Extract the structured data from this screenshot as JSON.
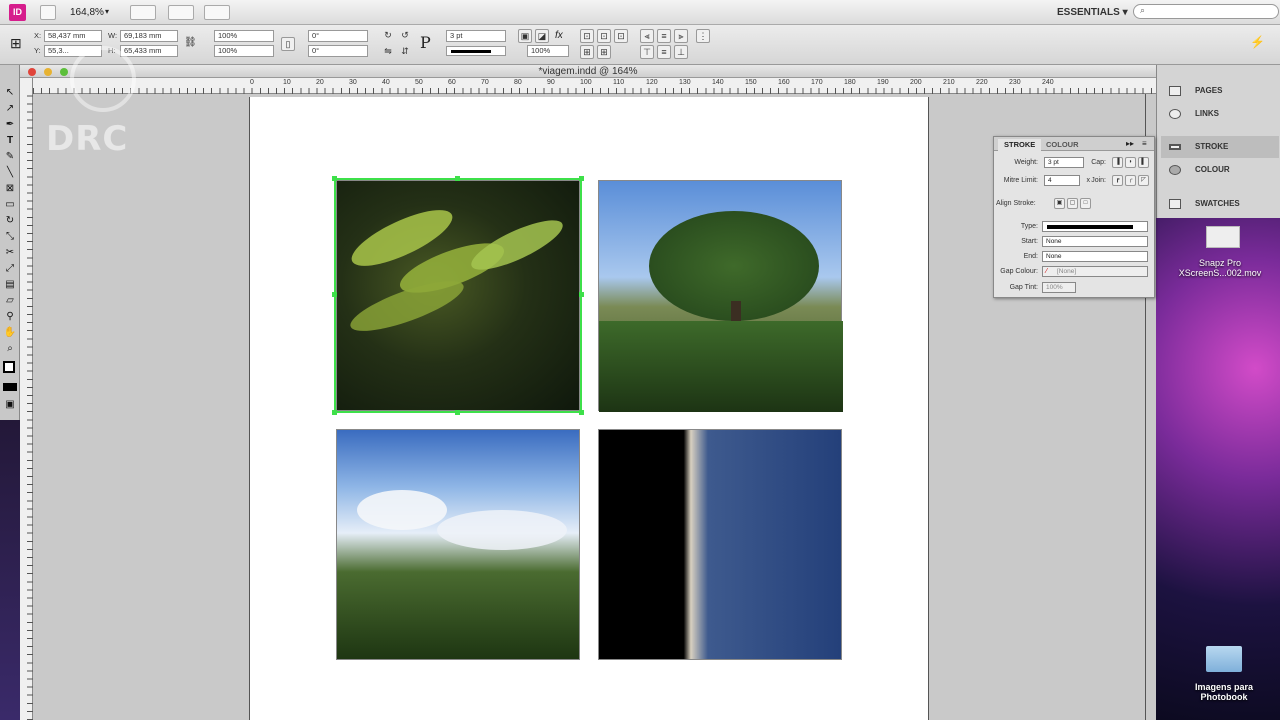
{
  "app": {
    "logo": "ID",
    "zoom": "164,8%",
    "workspace": "ESSENTIALS",
    "search_placeholder": ""
  },
  "control": {
    "x_label": "X:",
    "x_value": "58,437 mm",
    "y_label": "Y:",
    "y_value": "55,3...",
    "w_label": "W:",
    "w_value": "69,183 mm",
    "h_label": "H:",
    "h_value": "65,433 mm",
    "scale_x": "100%",
    "scale_y": "100%",
    "rotate": "0°",
    "shear": "0°",
    "stroke_weight": "3 pt",
    "opacity": "100%"
  },
  "document": {
    "title": "*viagem.indd @ 164%"
  },
  "ruler": {
    "ticks": [
      "0",
      "10",
      "20",
      "30",
      "40",
      "50",
      "60",
      "70",
      "80",
      "90",
      "100",
      "110",
      "120",
      "130",
      "140",
      "150",
      "160",
      "170",
      "180",
      "190",
      "200",
      "210",
      "220",
      "230",
      "240"
    ]
  },
  "dock": {
    "items": [
      {
        "label": "PAGES",
        "icon": "pages-icon"
      },
      {
        "label": "LINKS",
        "icon": "links-icon"
      },
      {
        "label": "STROKE",
        "icon": "stroke-icon"
      },
      {
        "label": "COLOUR",
        "icon": "colour-icon"
      },
      {
        "label": "SWATCHES",
        "icon": "swatches-icon"
      }
    ]
  },
  "stroke_panel": {
    "tab_stroke": "STROKE",
    "tab_colour": "COLOUR",
    "weight_label": "Weight:",
    "weight_value": "3 pt",
    "cap_label": "Cap:",
    "mitre_label": "Mitre Limit:",
    "mitre_value": "4",
    "mitre_x": "x",
    "join_label": "Join:",
    "align_label": "Align Stroke:",
    "type_label": "Type:",
    "start_label": "Start:",
    "start_value": "None",
    "end_label": "End:",
    "end_value": "None",
    "gap_colour_label": "Gap Colour:",
    "gap_colour_value": "[None]",
    "gap_tint_label": "Gap Tint:",
    "gap_tint_value": "100%"
  },
  "desktop": {
    "icons": [
      {
        "label": "Snapz Pro XScreenS...002.mov"
      },
      {
        "label": "Imagens para Photobook"
      }
    ]
  },
  "watermark": {
    "text": "DRC"
  }
}
